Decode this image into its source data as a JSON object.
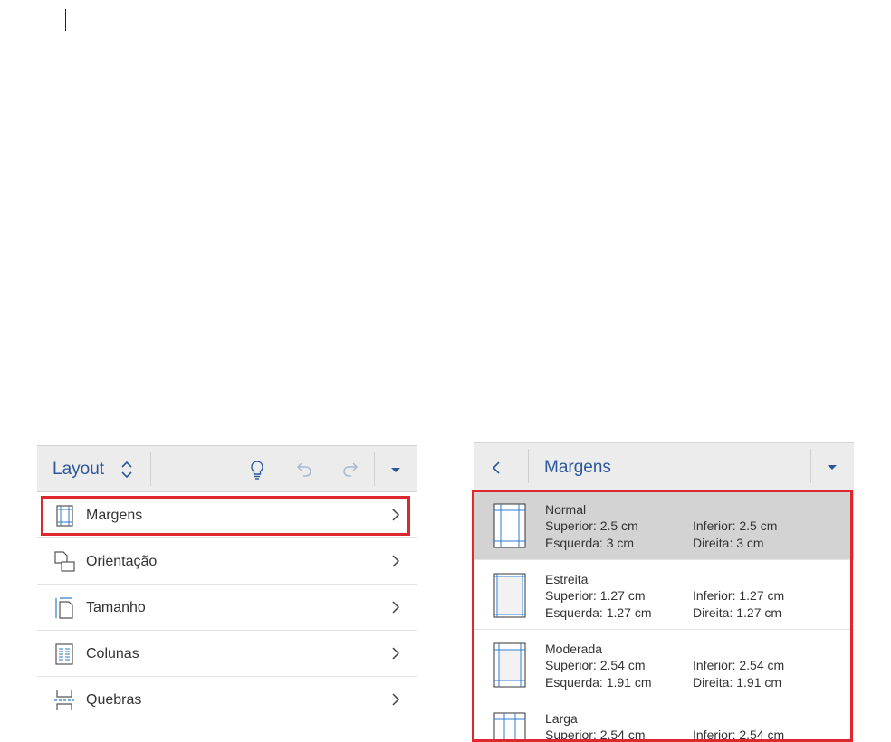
{
  "layout_panel": {
    "title": "Layout",
    "items": [
      {
        "label": "Margens",
        "icon": "margins-icon"
      },
      {
        "label": "Orientação",
        "icon": "orientation-icon"
      },
      {
        "label": "Tamanho",
        "icon": "size-icon"
      },
      {
        "label": "Colunas",
        "icon": "columns-icon"
      },
      {
        "label": "Quebras",
        "icon": "breaks-icon"
      }
    ]
  },
  "margins_panel": {
    "title": "Margens",
    "options": [
      {
        "name": "Normal",
        "superior": "Superior: 2.5 cm",
        "inferior": "Inferior: 2.5 cm",
        "esquerda": "Esquerda: 3 cm",
        "direita": "Direita: 3 cm",
        "selected": true
      },
      {
        "name": "Estreita",
        "superior": "Superior: 1.27 cm",
        "inferior": "Inferior: 1.27 cm",
        "esquerda": "Esquerda: 1.27 cm",
        "direita": "Direita: 1.27 cm",
        "selected": false
      },
      {
        "name": "Moderada",
        "superior": "Superior: 2.54 cm",
        "inferior": "Inferior: 2.54 cm",
        "esquerda": "Esquerda: 1.91 cm",
        "direita": "Direita: 1.91 cm",
        "selected": false
      },
      {
        "name": "Larga",
        "superior": "Superior: 2.54 cm",
        "inferior": "Inferior: 2.54 cm",
        "esquerda": "",
        "direita": "",
        "selected": false
      }
    ]
  },
  "colors": {
    "accent": "#2b579a",
    "highlight": "#e0262f",
    "selected_bg": "#d3d3d3",
    "toolbar_bg": "#ececec"
  }
}
